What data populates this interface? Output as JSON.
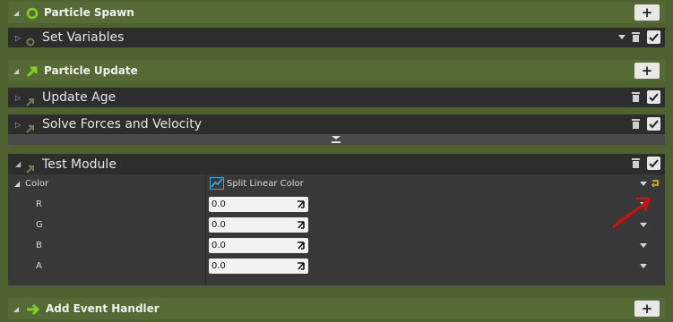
{
  "particle_spawn": {
    "label": "Particle Spawn",
    "add_label": "+"
  },
  "set_variables": {
    "label": "Set Variables"
  },
  "particle_update": {
    "label": "Particle Update",
    "add_label": "+"
  },
  "update_age": {
    "label": "Update Age"
  },
  "solve_forces": {
    "label": "Solve Forces and Velocity"
  },
  "test_module": {
    "label": "Test Module",
    "color_property": {
      "label": "Color",
      "dynamic_input": "Split Linear Color"
    },
    "channels": [
      {
        "label": "R",
        "value": "0.0"
      },
      {
        "label": "G",
        "value": "0.0"
      },
      {
        "label": "B",
        "value": "0.0"
      },
      {
        "label": "A",
        "value": "0.0"
      }
    ]
  },
  "event_handler": {
    "label": "Add Event Handler",
    "add_label": "+"
  },
  "colors": {
    "background": "#4f6131",
    "module_row": "#2d2d2d",
    "panel": "#383838",
    "spawn_accent": "#7ed321",
    "annotation_red": "#d01010",
    "reset_yellow": "#e8c21a"
  }
}
